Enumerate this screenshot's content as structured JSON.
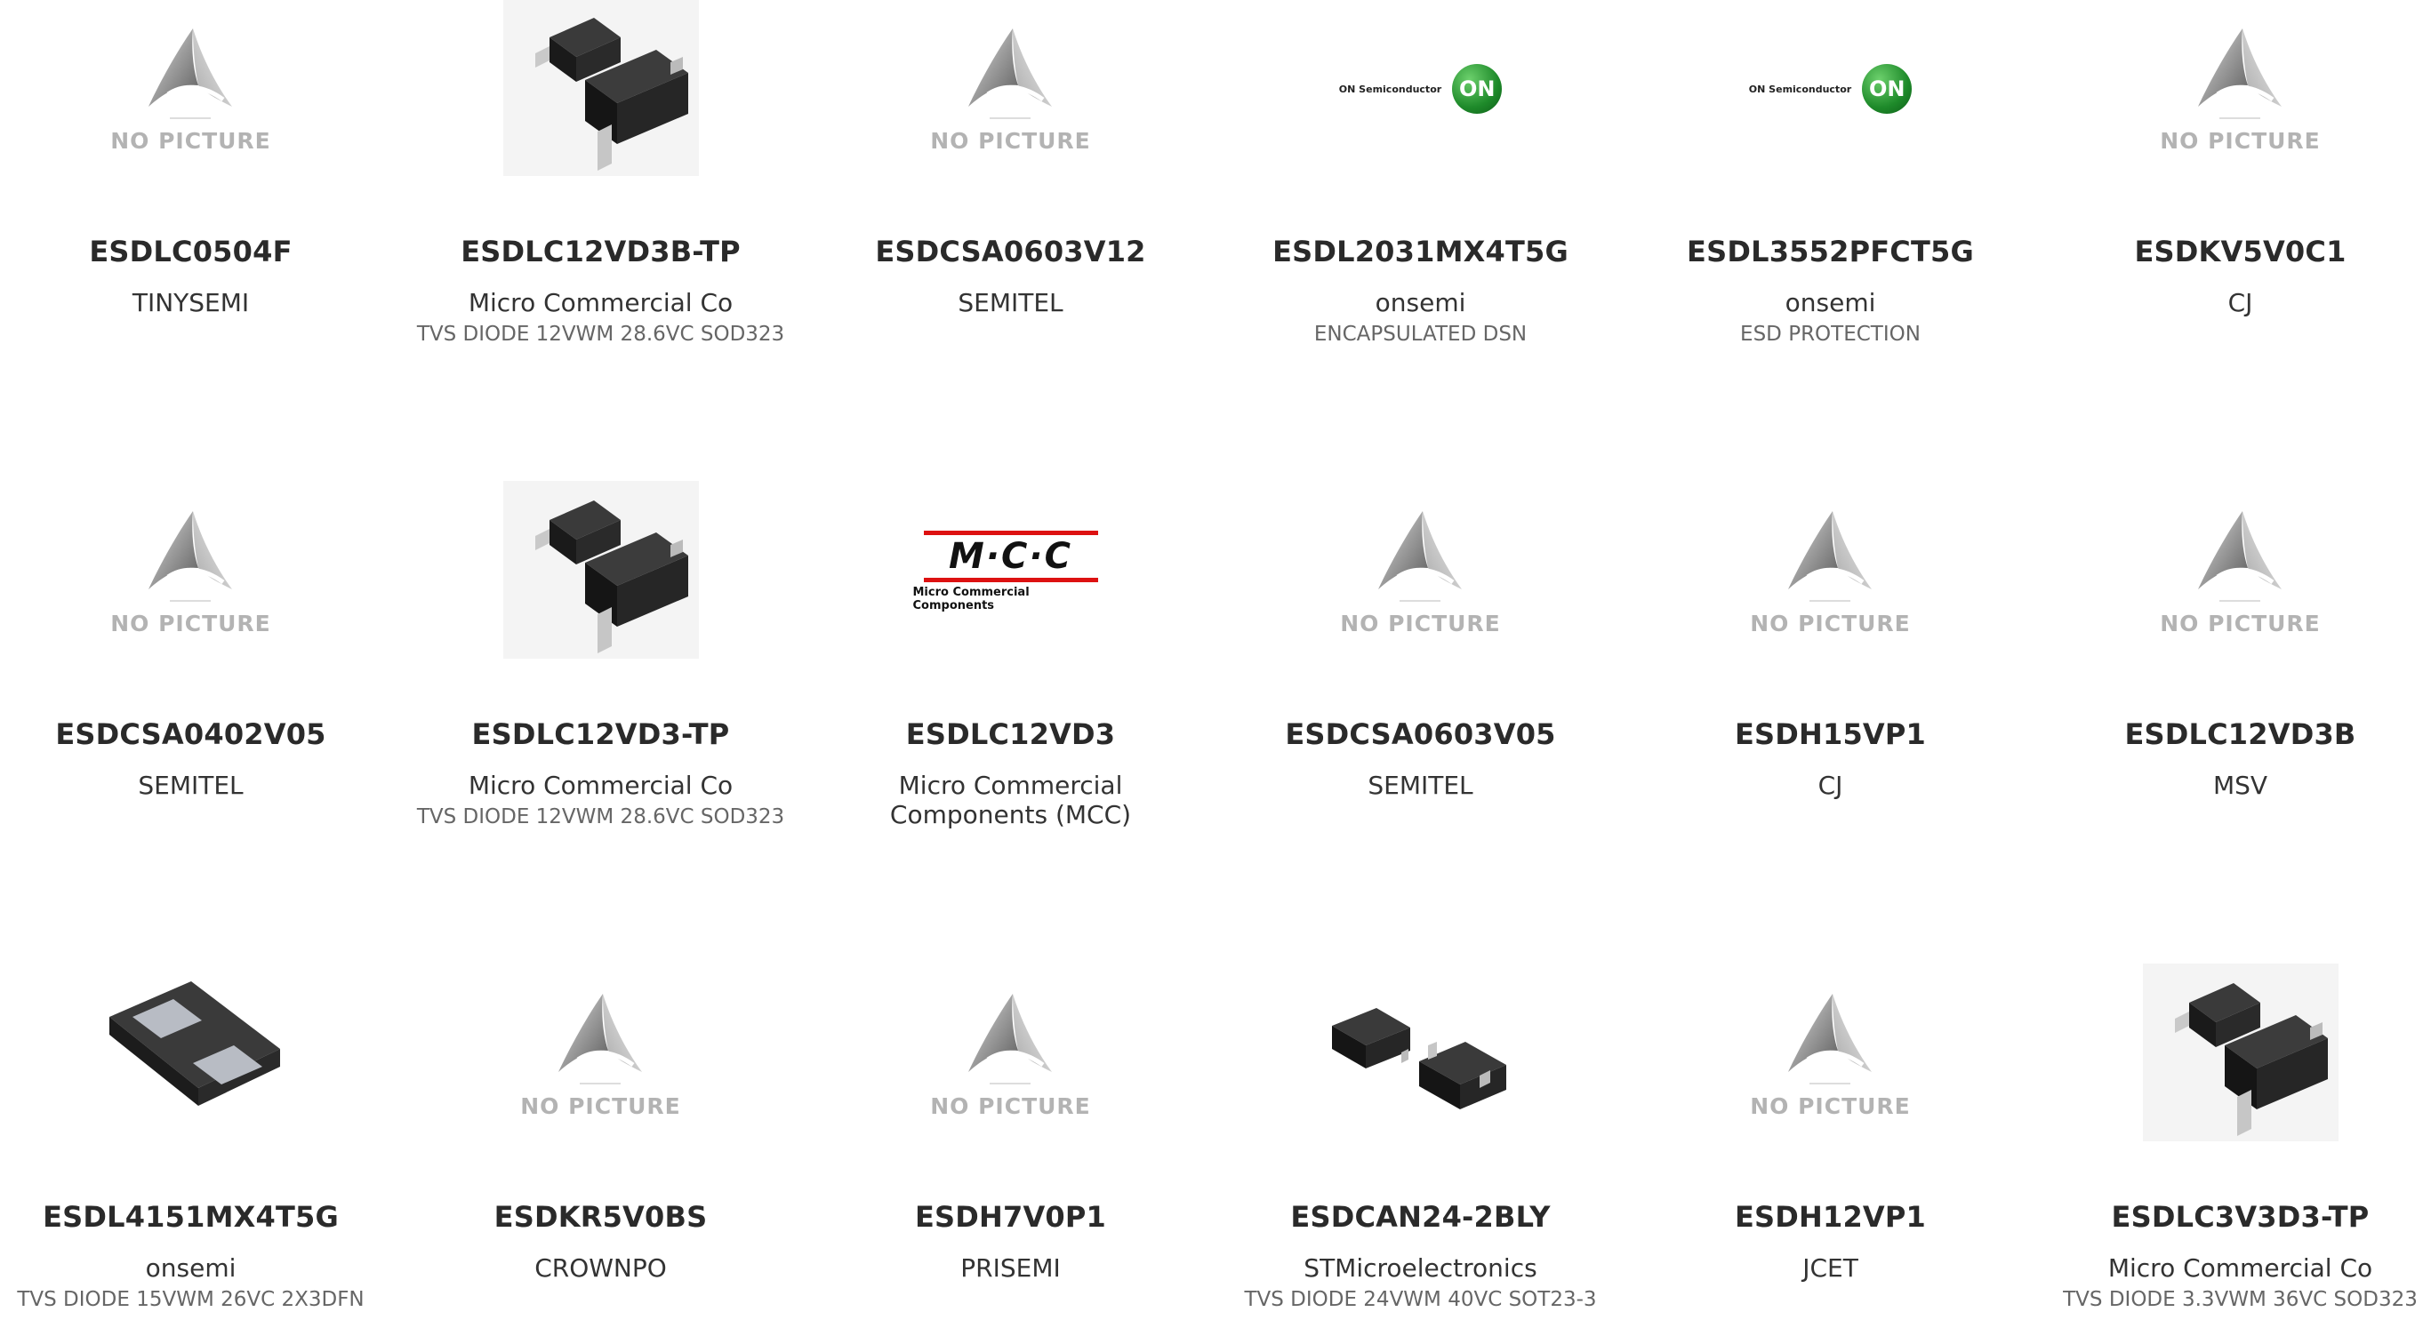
{
  "placeholder_text": "NO PICTURE",
  "products": [
    {
      "part": "ESDLC0504F",
      "manufacturer": "TINYSEMI",
      "description": "",
      "image": "no-picture"
    },
    {
      "part": "ESDLC12VD3B-TP",
      "manufacturer": "Micro Commercial Co",
      "description": "TVS DIODE 12VWM 28.6VC SOD323",
      "image": "sod323-package"
    },
    {
      "part": "ESDCSA0603V12",
      "manufacturer": "SEMITEL",
      "description": "",
      "image": "no-picture"
    },
    {
      "part": "ESDL2031MX4T5G",
      "manufacturer": "onsemi",
      "description": "ENCAPSULATED DSN",
      "image": "onsemi-logo"
    },
    {
      "part": "ESDL3552PFCT5G",
      "manufacturer": "onsemi",
      "description": "ESD PROTECTION",
      "image": "onsemi-logo"
    },
    {
      "part": "ESDKV5V0C1",
      "manufacturer": "CJ",
      "description": "",
      "image": "no-picture"
    },
    {
      "part": "ESDCSA0402V05",
      "manufacturer": "SEMITEL",
      "description": "",
      "image": "no-picture"
    },
    {
      "part": "ESDLC12VD3-TP",
      "manufacturer": "Micro Commercial Co",
      "description": "TVS DIODE 12VWM 28.6VC SOD323",
      "image": "sod323-package"
    },
    {
      "part": "ESDLC12VD3",
      "manufacturer": "Micro Commercial Components (MCC)",
      "description": "",
      "image": "mcc-logo"
    },
    {
      "part": "ESDCSA0603V05",
      "manufacturer": "SEMITEL",
      "description": "",
      "image": "no-picture"
    },
    {
      "part": "ESDH15VP1",
      "manufacturer": "CJ",
      "description": "",
      "image": "no-picture"
    },
    {
      "part": "ESDLC12VD3B",
      "manufacturer": "MSV",
      "description": "",
      "image": "no-picture"
    },
    {
      "part": "ESDL4151MX4T5G",
      "manufacturer": "onsemi",
      "description": "TVS DIODE 15VWM 26VC 2X3DFN",
      "image": "dfn-package"
    },
    {
      "part": "ESDKR5V0BS",
      "manufacturer": "CROWNPO",
      "description": "",
      "image": "no-picture"
    },
    {
      "part": "ESDH7V0P1",
      "manufacturer": "PRISEMI",
      "description": "",
      "image": "no-picture"
    },
    {
      "part": "ESDCAN24-2BLY",
      "manufacturer": "STMicroelectronics",
      "description": "TVS DIODE 24VWM 40VC SOT23-3",
      "image": "sot23-package"
    },
    {
      "part": "ESDH12VP1",
      "manufacturer": "JCET",
      "description": "",
      "image": "no-picture"
    },
    {
      "part": "ESDLC3V3D3-TP",
      "manufacturer": "Micro Commercial Co",
      "description": "TVS DIODE 3.3VWM 36VC SOD323",
      "image": "sod323-package"
    }
  ],
  "logos": {
    "onsemi_text": "ON Semiconductor",
    "onsemi_mark": "ON",
    "mcc_main": "M·C·C",
    "mcc_sub": "Micro Commercial Components"
  }
}
